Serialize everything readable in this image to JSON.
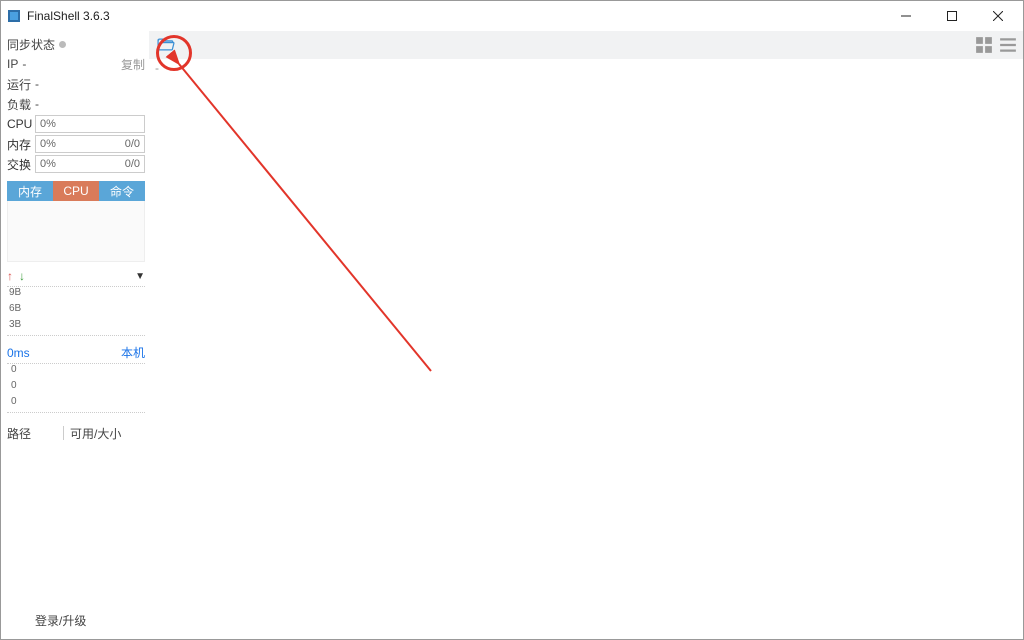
{
  "title": "FinalShell 3.6.3",
  "sidebar": {
    "sync_label": "同步状态",
    "ip_label": "IP",
    "ip_value": "-",
    "copy_label": "复制",
    "run_label": "运行",
    "run_value": "-",
    "load_label": "负载",
    "load_value": "-",
    "cpu_label": "CPU",
    "cpu_value": "0%",
    "mem_label": "内存",
    "mem_value": "0%",
    "mem_detail": "0/0",
    "swap_label": "交换",
    "swap_value": "0%",
    "swap_detail": "0/0",
    "tabs": {
      "mem": "内存",
      "cpu": "CPU",
      "cmd": "命令"
    },
    "net_yticks": [
      "9B",
      "6B",
      "3B"
    ],
    "ping_ms": "0ms",
    "ping_host": "本机",
    "ping_yticks": [
      "0",
      "0",
      "0"
    ],
    "disk_path": "路径",
    "disk_avail": "可用/大小",
    "login": "登录/升级"
  },
  "toolbar": {
    "dash_text": "-"
  },
  "chart_data": [
    {
      "type": "line",
      "name": "network-traffic",
      "series": [
        {
          "name": "up",
          "values": []
        },
        {
          "name": "down",
          "values": []
        }
      ],
      "ylabel": "bytes",
      "yticks": [
        "9B",
        "6B",
        "3B"
      ],
      "ylim": [
        0,
        10
      ]
    },
    {
      "type": "line",
      "name": "ping-latency",
      "series": [
        {
          "name": "latency_ms",
          "values": []
        }
      ],
      "ylabel": "ms",
      "yticks": [
        0,
        0,
        0
      ],
      "current": "0ms",
      "host": "本机"
    }
  ]
}
